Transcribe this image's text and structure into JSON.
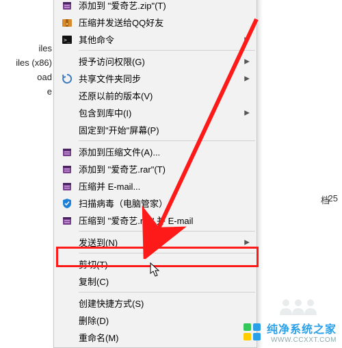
{
  "background": {
    "folder_labels": [
      "iles",
      "iles (x86)",
      "oad",
      "e"
    ],
    "col_text_1": "档",
    "col_text_2": "25"
  },
  "menu": {
    "items": [
      {
        "icon": "winrar",
        "label": "添加到 \"爱奇艺.zip\"(T)",
        "submenu": false
      },
      {
        "icon": "zipqq",
        "label": "压缩并发送给QQ好友",
        "submenu": false
      },
      {
        "icon": "cmd",
        "label": "其他命令",
        "submenu": true
      },
      {
        "sep": true
      },
      {
        "icon": "",
        "label": "授予访问权限(G)",
        "submenu": true
      },
      {
        "icon": "sync",
        "label": "共享文件夹同步",
        "submenu": true
      },
      {
        "icon": "",
        "label": "还原以前的版本(V)",
        "submenu": false
      },
      {
        "icon": "",
        "label": "包含到库中(I)",
        "submenu": true
      },
      {
        "icon": "",
        "label": "固定到\"开始\"屏幕(P)",
        "submenu": false
      },
      {
        "sep": true
      },
      {
        "icon": "winrar",
        "label": "添加到压缩文件(A)...",
        "submenu": false
      },
      {
        "icon": "winrar",
        "label": "添加到 \"爱奇艺.rar\"(T)",
        "submenu": false
      },
      {
        "icon": "winrar",
        "label": "压缩并 E-mail...",
        "submenu": false
      },
      {
        "icon": "shield",
        "label": "扫描病毒（电脑管家）",
        "submenu": false
      },
      {
        "icon": "winrar",
        "label": "压缩到 \"爱奇艺.rar\" 并 E-mail",
        "submenu": false
      },
      {
        "sep": true
      },
      {
        "icon": "",
        "label": "发送到(N)",
        "submenu": true
      },
      {
        "sep": true
      },
      {
        "icon": "",
        "label": "剪切(T)",
        "submenu": false,
        "highlighted": true
      },
      {
        "icon": "",
        "label": "复制(C)",
        "submenu": false
      },
      {
        "sep": true
      },
      {
        "icon": "",
        "label": "创建快捷方式(S)",
        "submenu": false
      },
      {
        "icon": "",
        "label": "删除(D)",
        "submenu": false
      },
      {
        "icon": "",
        "label": "重命名(M)",
        "submenu": false
      }
    ]
  },
  "annotation": {
    "arrow_color": "#ff1a1a",
    "box_color": "#ff1a1a"
  },
  "watermark": {
    "title": "纯净系统之家",
    "sub": "WWW.CCXXT.COM",
    "logo_colors": [
      "#34c759",
      "#2aa0e8",
      "#ffcc00",
      "#ff3b30"
    ]
  }
}
